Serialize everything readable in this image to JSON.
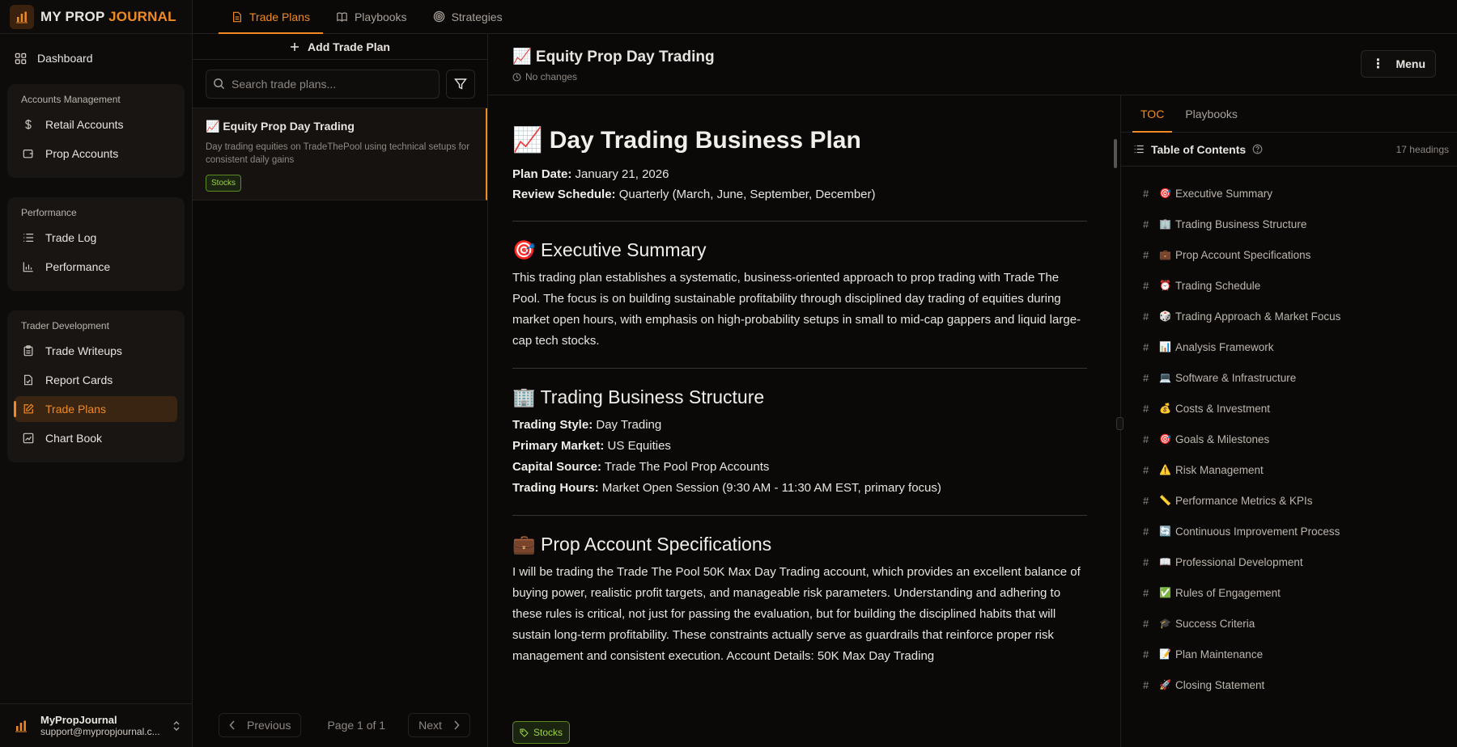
{
  "app": {
    "name_main": "MY PROP ",
    "name_accent": "JOURNAL"
  },
  "sidebar": {
    "dashboard": "Dashboard",
    "groups": [
      {
        "title": "Accounts Management",
        "items": [
          "Retail Accounts",
          "Prop Accounts"
        ]
      },
      {
        "title": "Performance",
        "items": [
          "Trade Log",
          "Performance"
        ]
      },
      {
        "title": "Trader Development",
        "items": [
          "Trade Writeups",
          "Report Cards",
          "Trade Plans",
          "Chart Book"
        ]
      }
    ],
    "user": {
      "name": "MyPropJournal",
      "email": "support@mypropjournal.c..."
    }
  },
  "top_tabs": [
    "Trade Plans",
    "Playbooks",
    "Strategies"
  ],
  "list_panel": {
    "add_label": "Add Trade Plan",
    "search_placeholder": "Search trade plans...",
    "card": {
      "title": "📈 Equity Prop Day Trading",
      "desc": "Day trading equities on TradeThePool using technical setups for consistent daily gains",
      "tag": "Stocks"
    },
    "pager": {
      "prev": "Previous",
      "info": "Page 1 of 1",
      "next": "Next"
    }
  },
  "editor": {
    "title": "📈 Equity Prop Day Trading",
    "status": "No changes",
    "menu": "Menu",
    "doc": {
      "h1": "📈 Day Trading Business Plan",
      "plan_date_label": "Plan Date:",
      "plan_date": " January 21, 2026",
      "review_label": "Review Schedule:",
      "review": " Quarterly (March, June, September, December)",
      "exec_h": "🎯 Executive Summary",
      "exec_p": "This trading plan establishes a systematic, business-oriented approach to prop trading with Trade The Pool. The focus is on building sustainable profitability through disciplined day trading of equities during market open hours, with emphasis on high-probability setups in small to mid-cap gappers and liquid large-cap tech stocks.",
      "struct_h": "🏢 Trading Business Structure",
      "style_label": "Trading Style:",
      "style": " Day Trading",
      "market_label": "Primary Market:",
      "market": " US Equities",
      "capital_label": "Capital Source:",
      "capital": " Trade The Pool Prop Accounts",
      "hours_label": "Trading Hours:",
      "hours": " Market Open Session (9:30 AM - 11:30 AM EST, primary focus)",
      "prop_h": "💼 Prop Account Specifications",
      "prop_p": "I will be trading the Trade The Pool 50K Max Day Trading account, which provides an excellent balance of buying power, realistic profit targets, and manageable risk parameters. Understanding and adhering to these rules is critical, not just for passing the evaluation, but for building the disciplined habits that will sustain long-term profitability. These constraints actually serve as guardrails that reinforce proper risk management and consistent execution. Account Details: 50K Max Day Trading"
    },
    "tag": "Stocks"
  },
  "toc": {
    "tabs": [
      "TOC",
      "Playbooks"
    ],
    "title": "Table of Contents",
    "count": "17 headings",
    "items": [
      {
        "icon": "🎯",
        "label": "Executive Summary"
      },
      {
        "icon": "🏢",
        "label": "Trading Business Structure"
      },
      {
        "icon": "💼",
        "label": "Prop Account Specifications"
      },
      {
        "icon": "⏰",
        "label": "Trading Schedule"
      },
      {
        "icon": "🎲",
        "label": "Trading Approach & Market Focus"
      },
      {
        "icon": "📊",
        "label": "Analysis Framework"
      },
      {
        "icon": "💻",
        "label": "Software & Infrastructure"
      },
      {
        "icon": "💰",
        "label": "Costs & Investment"
      },
      {
        "icon": "🎯",
        "label": "Goals & Milestones"
      },
      {
        "icon": "⚠️",
        "label": "Risk Management"
      },
      {
        "icon": "📏",
        "label": "Performance Metrics & KPIs"
      },
      {
        "icon": "🔄",
        "label": "Continuous Improvement Process"
      },
      {
        "icon": "📖",
        "label": "Professional Development"
      },
      {
        "icon": "✅",
        "label": "Rules of Engagement"
      },
      {
        "icon": "🎓",
        "label": "Success Criteria"
      },
      {
        "icon": "📝",
        "label": "Plan Maintenance"
      },
      {
        "icon": "🚀",
        "label": "Closing Statement"
      }
    ]
  },
  "colors": {
    "accent": "#f08a24",
    "tag_green": "#9bd146",
    "bg": "#0b0908"
  }
}
